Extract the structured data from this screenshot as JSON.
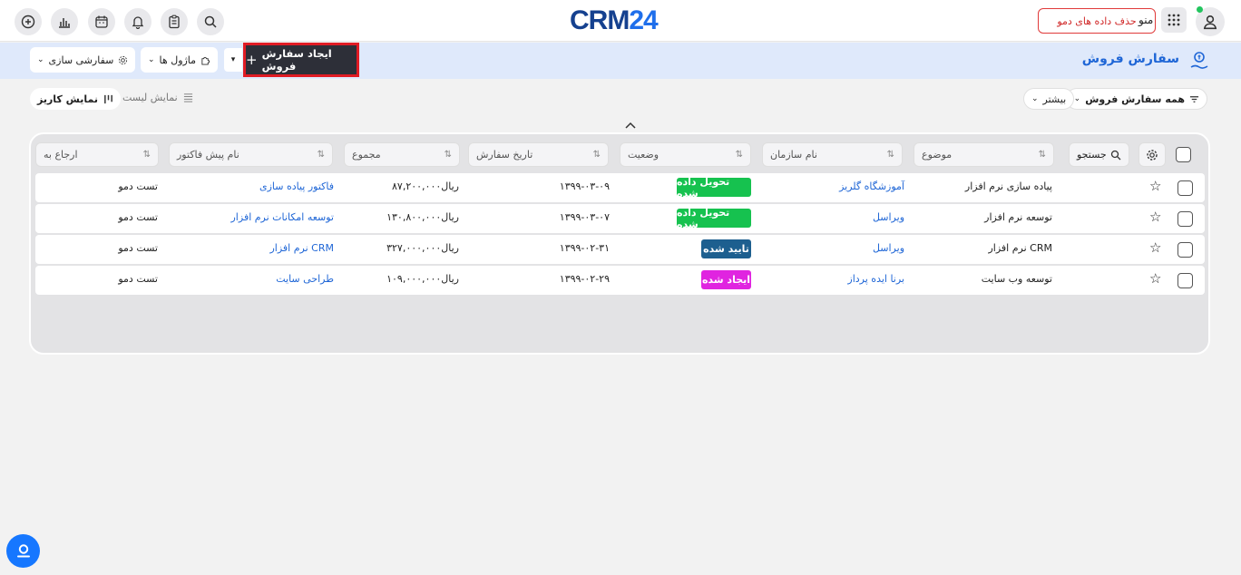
{
  "header": {
    "logo_main": "CRM",
    "logo_num": "24",
    "demo_button": "حذف داده های دمو",
    "menu_label": "منو"
  },
  "subbar": {
    "title": "سفارش فروش",
    "create_button": "ایجاد سفارش فروش",
    "modules_label": "ماژول ها",
    "customize_label": "سفارشی سازی"
  },
  "filters": {
    "all_orders": "همه سفارش فروش",
    "more": "بیشتر",
    "kanban_view": "نمایش کاریز",
    "list_view": "نمایش لیست"
  },
  "table": {
    "search_label": "جستجو",
    "columns": [
      "موضوع",
      "نام سازمان",
      "وضعیت",
      "تاریخ سفارش",
      "مجموع",
      "نام پیش فاکتور",
      "ارجاع به"
    ],
    "rows": [
      {
        "subject": "پیاده سازی نرم افزار",
        "org": "آموزشگاه گلریز",
        "status": "تحویل داده شده",
        "status_color": "#16c24f",
        "date": "۱۳۹۹-۰۳-۰۹",
        "total": "۸۷,۲۰۰,۰۰۰ریال",
        "quote": "فاکتور پیاده سازی",
        "assigned": "تست دمو"
      },
      {
        "subject": "توسعه نرم افزار",
        "org": "ویراسل",
        "status": "تحویل داده شده",
        "status_color": "#16c24f",
        "date": "۱۳۹۹-۰۳-۰۷",
        "total": "۱۳۰,۸۰۰,۰۰۰ریال",
        "quote": "توسعه امکانات نرم افزار",
        "assigned": "تست دمو"
      },
      {
        "subject": "نرم افزار CRM",
        "org": "ویراسل",
        "status": "تایید شده",
        "status_color": "#1d5f8f",
        "date": "۱۳۹۹-۰۲-۳۱",
        "total": "۳۲۷,۰۰۰,۰۰۰ریال",
        "quote": "نرم افزار CRM",
        "assigned": "تست دمو"
      },
      {
        "subject": "توسعه وب سایت",
        "org": "برنا ایده پرداز",
        "status": "ایجاد شده",
        "status_color": "#e024e0",
        "date": "۱۳۹۹-۰۲-۲۹",
        "total": "۱۰۹,۰۰۰,۰۰۰ریال",
        "quote": "طراحی سایت",
        "assigned": "تست دمو"
      }
    ]
  },
  "colors": {
    "accent": "#1f66d6",
    "create_highlight": "#e01b24",
    "subbar_bg": "#dfe9fb"
  }
}
